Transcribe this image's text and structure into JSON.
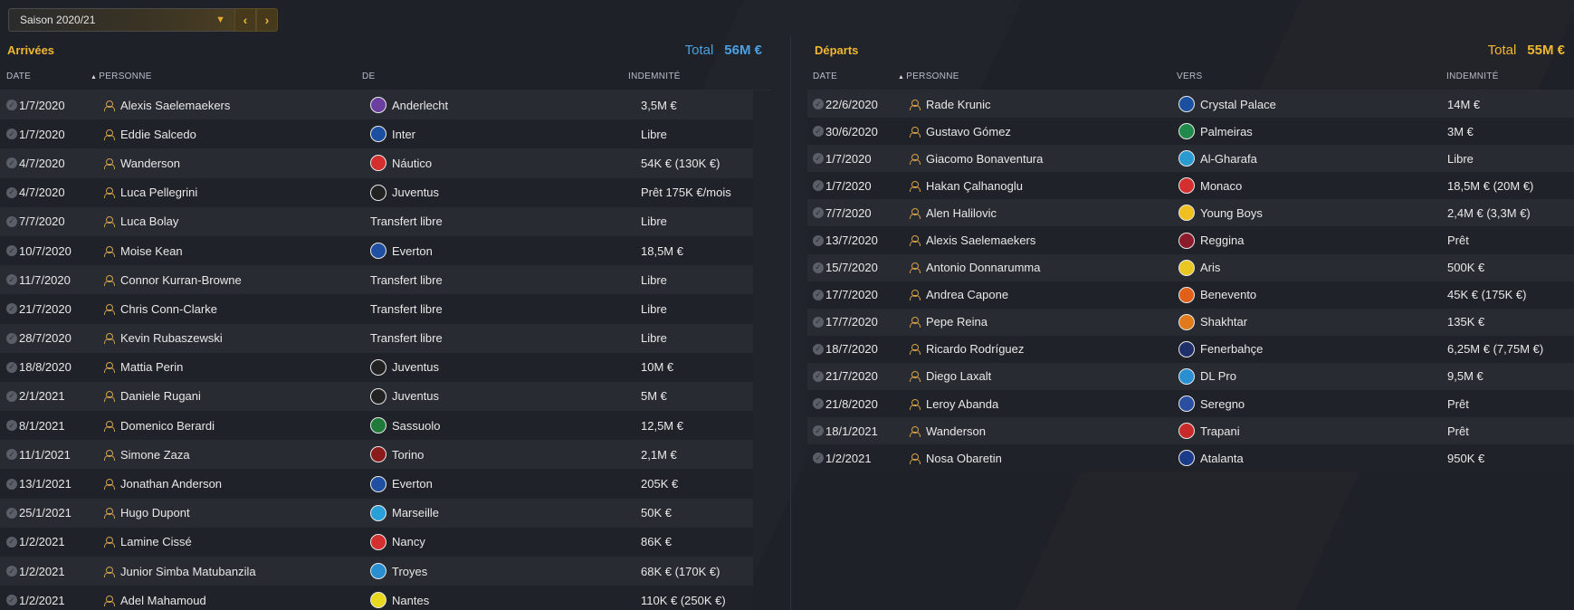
{
  "season": {
    "label": "Saison 2020/21"
  },
  "arrivals": {
    "title": "Arrivées",
    "total_label": "Total",
    "total_value": "56M €",
    "columns": {
      "date": "DATE",
      "person": "PERSONNE",
      "club": "DE",
      "fee": "INDEMNITÉ"
    },
    "rows": [
      {
        "date": "1/7/2020",
        "person": "Alexis Saelemaekers",
        "club": "Anderlecht",
        "club_icon": "anderlecht-icon",
        "club_color": "#6b3fa0",
        "fee": "3,5M €"
      },
      {
        "date": "1/7/2020",
        "person": "Eddie Salcedo",
        "club": "Inter",
        "club_icon": "inter-icon",
        "club_color": "#1d4fa0",
        "fee": "Libre"
      },
      {
        "date": "4/7/2020",
        "person": "Wanderson",
        "club": "Náutico",
        "club_icon": "nautico-icon",
        "club_color": "#d32f2f",
        "fee": "54K € (130K €)"
      },
      {
        "date": "4/7/2020",
        "person": "Luca Pellegrini",
        "club": "Juventus",
        "club_icon": "juventus-icon",
        "club_color": "#222222",
        "fee": "Prêt 175K €/mois"
      },
      {
        "date": "7/7/2020",
        "person": "Luca Bolay",
        "club": "Transfert libre",
        "club_icon": "",
        "club_color": "",
        "fee": "Libre"
      },
      {
        "date": "10/7/2020",
        "person": "Moise Kean",
        "club": "Everton",
        "club_icon": "everton-icon",
        "club_color": "#1f4fa0",
        "fee": "18,5M €"
      },
      {
        "date": "11/7/2020",
        "person": "Connor Kurran-Browne",
        "club": "Transfert libre",
        "club_icon": "",
        "club_color": "",
        "fee": "Libre"
      },
      {
        "date": "21/7/2020",
        "person": "Chris Conn-Clarke",
        "club": "Transfert libre",
        "club_icon": "",
        "club_color": "",
        "fee": "Libre"
      },
      {
        "date": "28/7/2020",
        "person": "Kevin Rubaszewski",
        "club": "Transfert libre",
        "club_icon": "",
        "club_color": "",
        "fee": "Libre"
      },
      {
        "date": "18/8/2020",
        "person": "Mattia Perin",
        "club": "Juventus",
        "club_icon": "juventus-icon",
        "club_color": "#222222",
        "fee": "10M €"
      },
      {
        "date": "2/1/2021",
        "person": "Daniele Rugani",
        "club": "Juventus",
        "club_icon": "juventus-icon",
        "club_color": "#222222",
        "fee": "5M €"
      },
      {
        "date": "8/1/2021",
        "person": "Domenico Berardi",
        "club": "Sassuolo",
        "club_icon": "sassuolo-icon",
        "club_color": "#1f7a3a",
        "fee": "12,5M €"
      },
      {
        "date": "11/1/2021",
        "person": "Simone Zaza",
        "club": "Torino",
        "club_icon": "torino-icon",
        "club_color": "#8b1a1a",
        "fee": "2,1M €"
      },
      {
        "date": "13/1/2021",
        "person": "Jonathan Anderson",
        "club": "Everton",
        "club_icon": "everton-icon",
        "club_color": "#1f4fa0",
        "fee": "205K €"
      },
      {
        "date": "25/1/2021",
        "person": "Hugo Dupont",
        "club": "Marseille",
        "club_icon": "marseille-icon",
        "club_color": "#2aa0d8",
        "fee": "50K €"
      },
      {
        "date": "1/2/2021",
        "person": "Lamine Cissé",
        "club": "Nancy",
        "club_icon": "nancy-icon",
        "club_color": "#d32f2f",
        "fee": "86K €"
      },
      {
        "date": "1/2/2021",
        "person": "Junior Simba Matubanzila",
        "club": "Troyes",
        "club_icon": "troyes-icon",
        "club_color": "#2a8fd0",
        "fee": "68K € (170K €)"
      },
      {
        "date": "1/2/2021",
        "person": "Adel Mahamoud",
        "club": "Nantes",
        "club_icon": "nantes-icon",
        "club_color": "#e8d820",
        "fee": "110K € (250K €)"
      }
    ]
  },
  "departures": {
    "title": "Départs",
    "total_label": "Total",
    "total_value": "55M €",
    "columns": {
      "date": "DATE",
      "person": "PERSONNE",
      "club": "VERS",
      "fee": "INDEMNITÉ"
    },
    "rows": [
      {
        "date": "22/6/2020",
        "person": "Rade Krunic",
        "club": "Crystal Palace",
        "club_icon": "crystal-palace-icon",
        "club_color": "#1b4fa0",
        "fee": "14M €"
      },
      {
        "date": "30/6/2020",
        "person": "Gustavo Gómez",
        "club": "Palmeiras",
        "club_icon": "palmeiras-icon",
        "club_color": "#1f8a4a",
        "fee": "3M €"
      },
      {
        "date": "1/7/2020",
        "person": "Giacomo Bonaventura",
        "club": "Al-Gharafa",
        "club_icon": "al-gharafa-icon",
        "club_color": "#2a9ad0",
        "fee": "Libre"
      },
      {
        "date": "1/7/2020",
        "person": "Hakan Çalhanoglu",
        "club": "Monaco",
        "club_icon": "monaco-icon",
        "club_color": "#d32f2f",
        "fee": "18,5M € (20M €)"
      },
      {
        "date": "7/7/2020",
        "person": "Alen Halilovic",
        "club": "Young Boys",
        "club_icon": "young-boys-icon",
        "club_color": "#f0c020",
        "fee": "2,4M € (3,3M €)"
      },
      {
        "date": "13/7/2020",
        "person": "Alexis Saelemaekers",
        "club": "Reggina",
        "club_icon": "reggina-icon",
        "club_color": "#8b1a2a",
        "fee": "Prêt"
      },
      {
        "date": "15/7/2020",
        "person": "Antonio Donnarumma",
        "club": "Aris",
        "club_icon": "aris-icon",
        "club_color": "#e8c820",
        "fee": "500K €"
      },
      {
        "date": "17/7/2020",
        "person": "Andrea Capone",
        "club": "Benevento",
        "club_icon": "benevento-icon",
        "club_color": "#e0601a",
        "fee": "45K € (175K €)"
      },
      {
        "date": "17/7/2020",
        "person": "Pepe Reina",
        "club": "Shakhtar",
        "club_icon": "shakhtar-icon",
        "club_color": "#e07a1a",
        "fee": "135K €"
      },
      {
        "date": "18/7/2020",
        "person": "Ricardo Rodríguez",
        "club": "Fenerbahçe",
        "club_icon": "fenerbahce-icon",
        "club_color": "#1f2f6a",
        "fee": "6,25M € (7,75M €)"
      },
      {
        "date": "21/7/2020",
        "person": "Diego Laxalt",
        "club": "DL Pro",
        "club_icon": "dl-pro-icon",
        "club_color": "#2a8fd0",
        "fee": "9,5M €"
      },
      {
        "date": "21/8/2020",
        "person": "Leroy Abanda",
        "club": "Seregno",
        "club_icon": "seregno-icon",
        "club_color": "#2a4fa0",
        "fee": "Prêt"
      },
      {
        "date": "18/1/2021",
        "person": "Wanderson",
        "club": "Trapani",
        "club_icon": "trapani-icon",
        "club_color": "#c82a2a",
        "fee": "Prêt"
      },
      {
        "date": "1/2/2021",
        "person": "Nosa Obaretin",
        "club": "Atalanta",
        "club_icon": "atalanta-icon",
        "club_color": "#1a3a8a",
        "fee": "950K €"
      }
    ]
  }
}
